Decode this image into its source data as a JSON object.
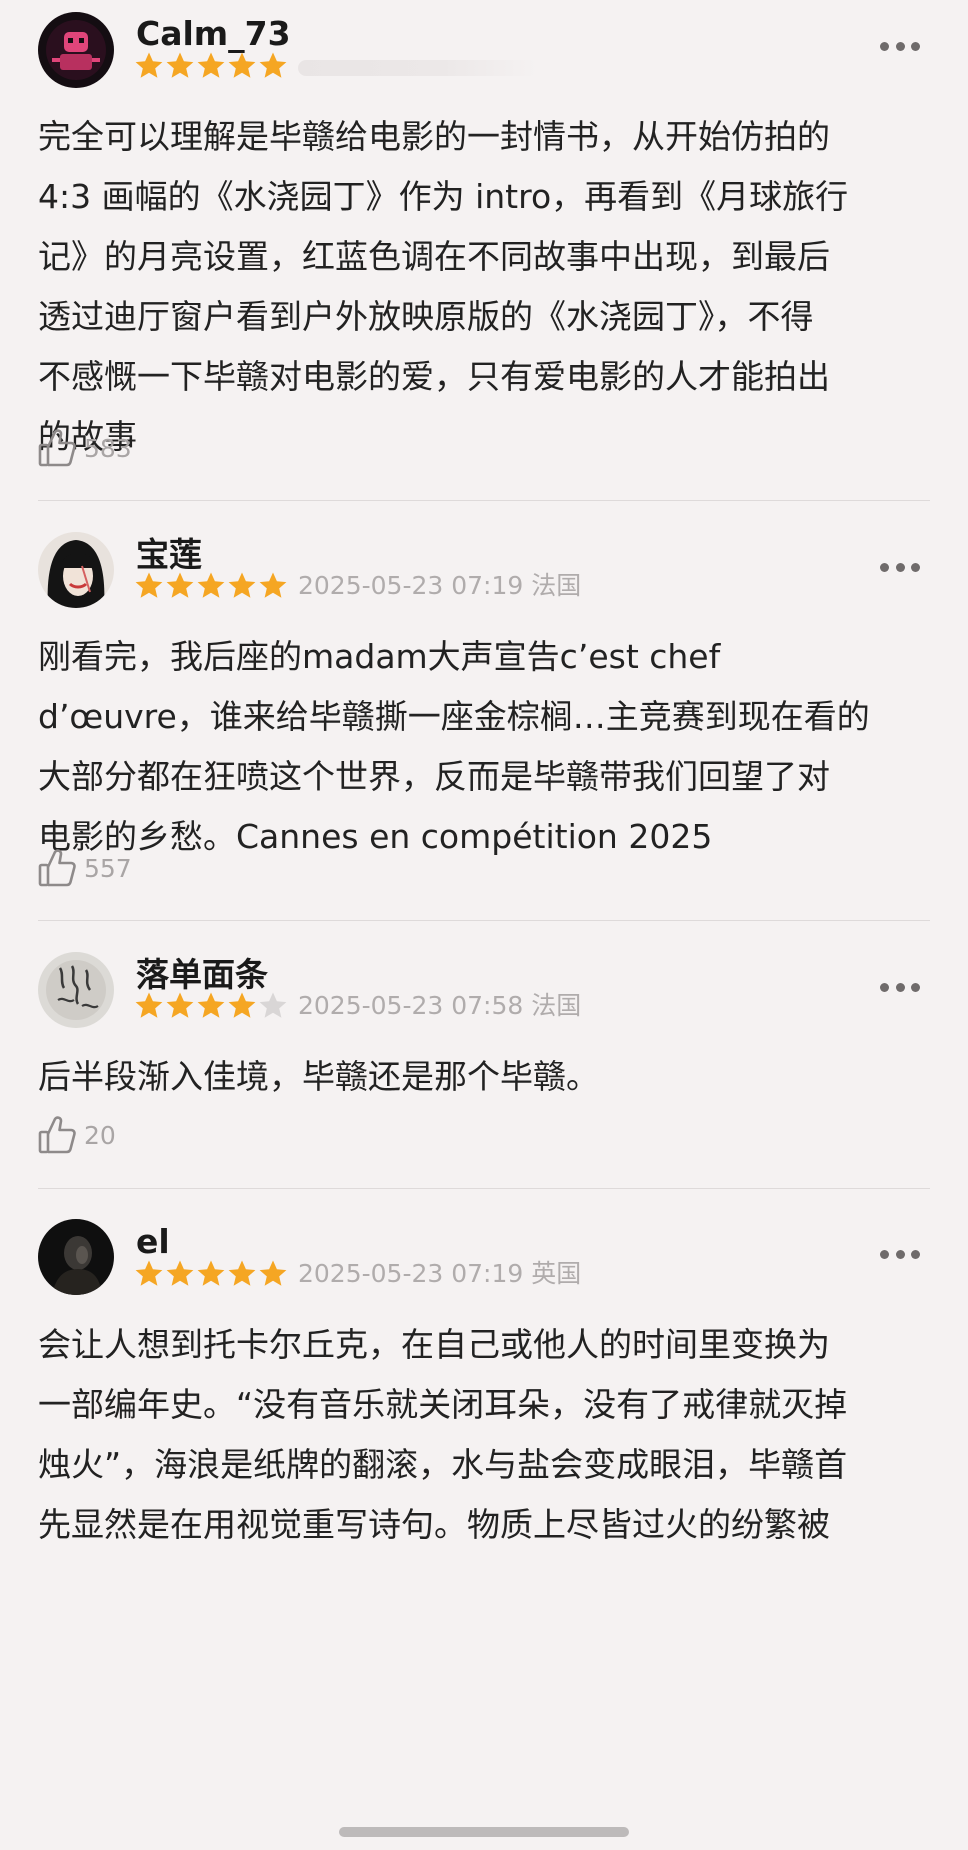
{
  "colors": {
    "background": "#f5f2f2",
    "star_filled": "#f5a623",
    "star_empty": "#d9d6d6",
    "meta_text": "#b0acac",
    "divider": "#dedada"
  },
  "icons": {
    "more": "more-dots-icon",
    "like": "thumbs-up-icon",
    "star": "star-icon"
  },
  "reviews": [
    {
      "username": "Calm_73",
      "rating": 5,
      "meta": "",
      "text": "完全可以理解是毕赣给电影的一封情书，从开始仿拍的\n4:3 画幅的《水浇园丁》作为 intro，再看到《月球旅行\n记》的月亮设置，红蓝色调在不同故事中出现，到最后\n透过迪厅窗户看到户外放映原版的《水浇园丁》，不得\n不感慨一下毕赣对电影的爱，只有爱电影的人才能拍出\n的故事",
      "likes": "583"
    },
    {
      "username": "宝莲",
      "rating": 5,
      "meta": "2025-05-23 07:19 法国",
      "text": "刚看完，我后座的madam大声宣告c’est chef\nd’œuvre，谁来给毕赣撕一座金棕榈…主竞赛到现在看的\n大部分都在狂喷这个世界，反而是毕赣带我们回望了对\n电影的乡愁。Cannes en compétition 2025",
      "likes": "557"
    },
    {
      "username": "落单面条",
      "rating": 4,
      "meta": "2025-05-23 07:58 法国",
      "text": "后半段渐入佳境，毕赣还是那个毕赣。",
      "likes": "20"
    },
    {
      "username": "el",
      "rating": 5,
      "meta": "2025-05-23 07:19 英国",
      "text": "会让人想到托卡尔丘克，在自己或他人的时间里变换为\n一部编年史。“没有音乐就关闭耳朵，没有了戒律就灭掉\n烛火”，海浪是纸牌的翻滚，水与盐会变成眼泪，毕赣首\n先显然是在用视觉重写诗句。物质上尽皆过火的纷繁被",
      "likes": ""
    }
  ]
}
